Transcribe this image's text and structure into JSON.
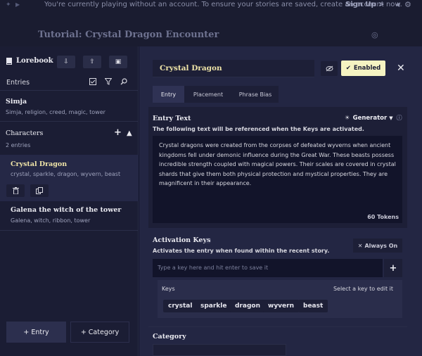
{
  "topbar": {
    "notice": "You're currently playing without an account. To ensure your stories are saved, create an account now.",
    "signup": "Sign Up >"
  },
  "header": {
    "title": "Tutorial: Crystal Dragon Encounter"
  },
  "sidebar": {
    "title": "Lorebook",
    "entries_label": "Entries",
    "simja": {
      "name": "Simja",
      "keys": "Simja, religion, creed, magic, tower"
    },
    "characters": {
      "label": "Characters",
      "count": "2 entries",
      "items": [
        {
          "name": "Crystal Dragon",
          "keys": "crystal, sparkle, dragon, wyvern, beast"
        },
        {
          "name": "Galena the witch of the tower",
          "keys": "Galena, witch, ribbon, tower"
        }
      ]
    },
    "add_entry": "+ Entry",
    "add_category": "+ Category"
  },
  "entry": {
    "title": "Crystal Dragon",
    "enabled_label": "Enabled",
    "tabs": [
      "Entry",
      "Placement",
      "Phrase Bias"
    ],
    "entry_text_label": "Entry Text",
    "generator_label": "Generator",
    "entry_text_hint": "The following text will be referenced when the Keys are activated.",
    "text": "Crystal dragons were created from the corpses of defeated wyverns when ancient kingdoms fell under demonic influence during the Great War. These beasts possess incredible strength coupled with magical powers. Their scales are covered in crystal shards that give them both physical protection and mystical properties. They are magnificent in their appearance.",
    "tokens": "60 Tokens",
    "activation_label": "Activation Keys",
    "activation_hint": "Activates the entry when found within the recent story.",
    "always_on": "Always On",
    "key_placeholder": "Type a key here and hit enter to save it",
    "keys_label": "Keys",
    "keys_hint": "Select a key to edit it",
    "keys": [
      "crystal",
      "sparkle",
      "dragon",
      "wyvern",
      "beast"
    ],
    "category_label": "Category"
  },
  "colors": {
    "accent": "#f5f3c2",
    "gold": "#f0e5a8",
    "bg": "#13152a"
  }
}
